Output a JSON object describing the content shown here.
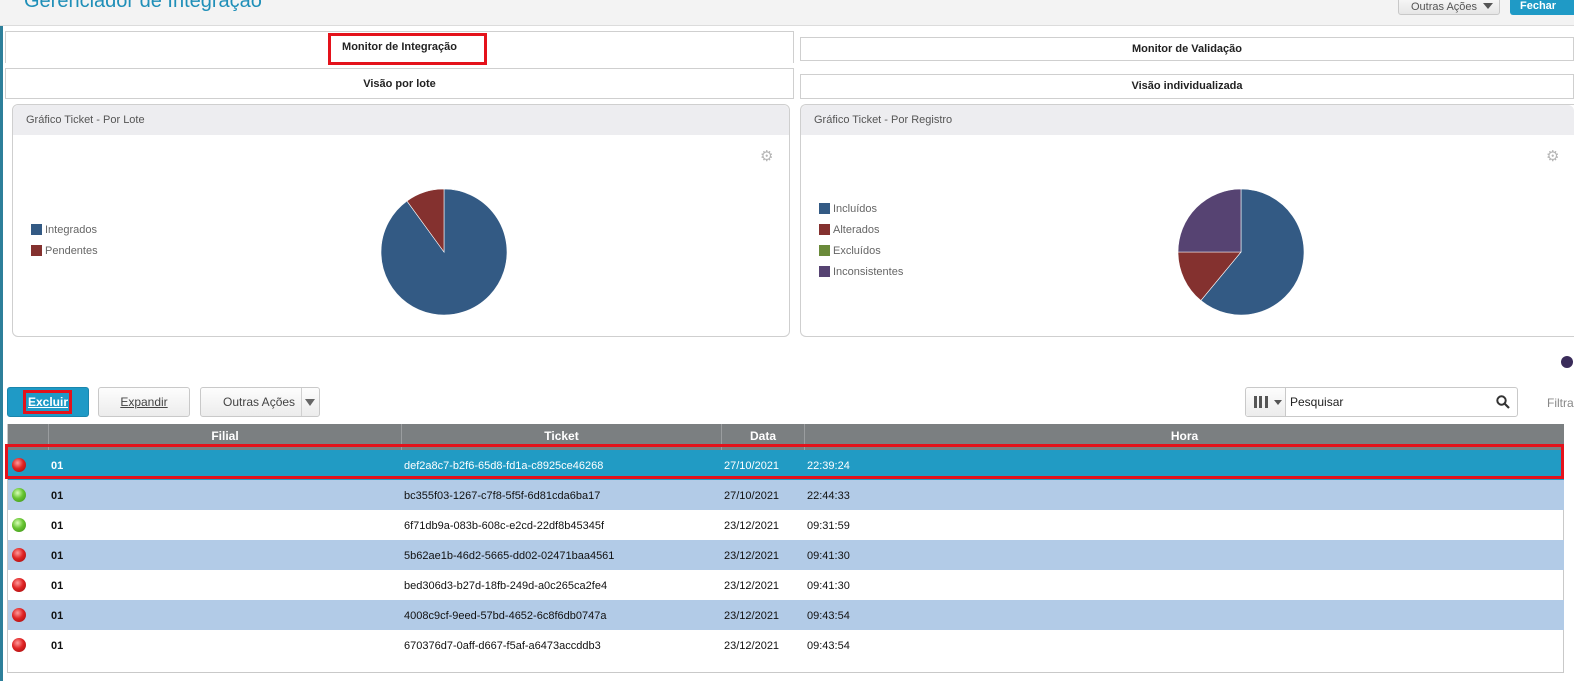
{
  "header": {
    "title": "Gerenciador de Integração",
    "actions_label": "Outras Ações",
    "confirm_label": "Fechar"
  },
  "tabs_primary": [
    {
      "label": "Monitor de Integração",
      "active": true
    },
    {
      "label": "Monitor de Validação",
      "active": false
    }
  ],
  "tabs_secondary": [
    {
      "label": "Visão por lote",
      "active": true
    },
    {
      "label": "Visão individualizada",
      "active": false
    }
  ],
  "chart_data": [
    {
      "type": "pie",
      "title": "Gráfico Ticket - Por Lote",
      "legend": [
        {
          "label": "Integrados",
          "color": "#335a84"
        },
        {
          "label": "Pendentes",
          "color": "#84312f"
        }
      ],
      "values": [
        90,
        10
      ],
      "legend_position": "left"
    },
    {
      "type": "pie",
      "title": "Gráfico Ticket - Por Registro",
      "legend": [
        {
          "label": "Incluídos",
          "color": "#335a84"
        },
        {
          "label": "Alterados",
          "color": "#84312f"
        },
        {
          "label": "Excluídos",
          "color": "#6a8a3a"
        },
        {
          "label": "Inconsistentes",
          "color": "#564372"
        }
      ],
      "values": [
        61,
        14,
        0,
        25
      ],
      "legend_position": "left"
    }
  ],
  "toolbar": {
    "excluir_label": "Excluir",
    "expandir_label": "Expandir",
    "outras_acoes_label": "Outras Ações"
  },
  "search": {
    "placeholder": "Pesquisar",
    "filter_label": "Filtrar"
  },
  "grid": {
    "columns": [
      "",
      "Filial",
      "Ticket",
      "Data",
      "Hora"
    ],
    "rows": [
      {
        "status": "red",
        "filial": "01",
        "ticket": "def2a8c7-b2f6-65d8-fd1a-c8925ce46268",
        "data": "27/10/2021",
        "hora": "22:39:24",
        "selected": true
      },
      {
        "status": "green",
        "filial": "01",
        "ticket": "bc355f03-1267-c7f8-5f5f-6d81cda6ba17",
        "data": "27/10/2021",
        "hora": "22:44:33"
      },
      {
        "status": "green",
        "filial": "01",
        "ticket": "6f71db9a-083b-608c-e2cd-22df8b45345f",
        "data": "23/12/2021",
        "hora": "09:31:59"
      },
      {
        "status": "red",
        "filial": "01",
        "ticket": "5b62ae1b-46d2-5665-dd02-02471baa4561",
        "data": "23/12/2021",
        "hora": "09:41:30"
      },
      {
        "status": "red",
        "filial": "01",
        "ticket": "bed306d3-b27d-18fb-249d-a0c265ca2fe4",
        "data": "23/12/2021",
        "hora": "09:41:30"
      },
      {
        "status": "red",
        "filial": "01",
        "ticket": "4008c9cf-9eed-57bd-4652-6c8f6db0747a",
        "data": "23/12/2021",
        "hora": "09:43:54"
      },
      {
        "status": "red",
        "filial": "01",
        "ticket": "670376d7-0aff-d667-f5af-a6473accddb3",
        "data": "23/12/2021",
        "hora": "09:43:54"
      }
    ]
  }
}
